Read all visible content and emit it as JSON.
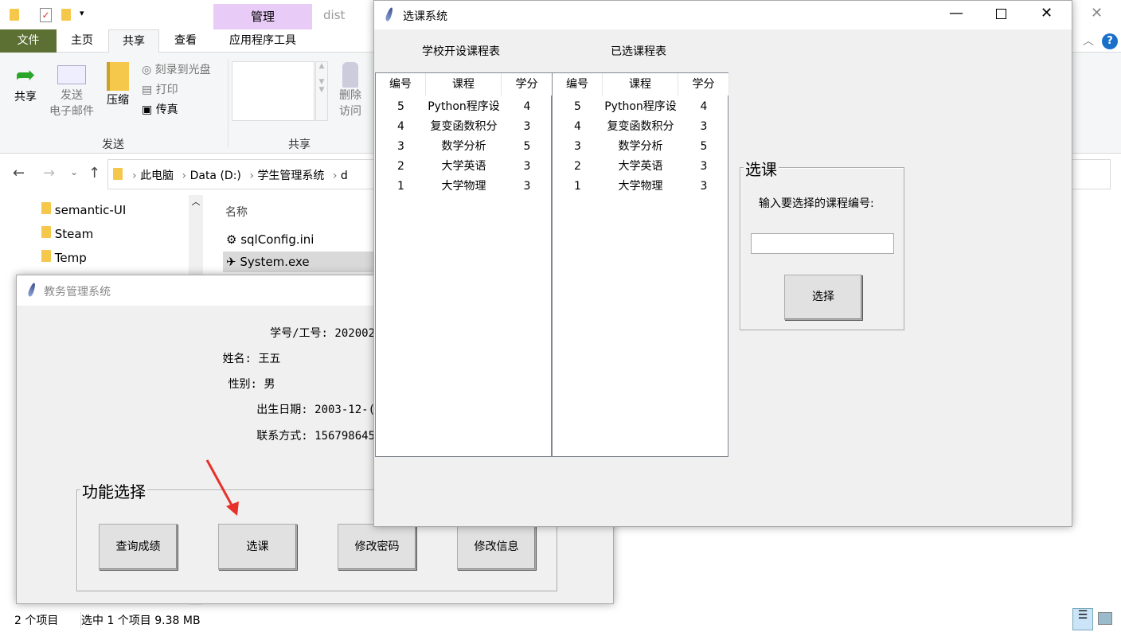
{
  "explorer": {
    "context_tab": "管理",
    "title": "dist",
    "tabs": [
      "文件",
      "主页",
      "共享",
      "查看",
      "应用程序工具"
    ],
    "ribbon": {
      "share": "共享",
      "send_email_1": "发送",
      "send_email_2": "电子邮件",
      "zip": "压缩",
      "burn": "刻录到光盘",
      "print": "打印",
      "fax": "传真",
      "remove_1": "删除",
      "remove_2": "访问",
      "group_send": "发送",
      "group_share": "共享"
    },
    "breadcrumb": [
      "此电脑",
      "Data (D:)",
      "学生管理系统",
      "d"
    ],
    "nav_items": [
      "semantic-UI",
      "Steam",
      "Temp"
    ],
    "column_name": "名称",
    "files": [
      "sqlConfig.ini",
      "System.exe"
    ],
    "status": {
      "count": "2 个项目",
      "selected": "选中 1 个项目  9.38 MB"
    }
  },
  "main_window": {
    "title": "教务管理系统",
    "fields": [
      {
        "label": "学号/工号:",
        "value": "202002"
      },
      {
        "label": "姓名:",
        "value": "王五"
      },
      {
        "label": "性别:",
        "value": "男"
      },
      {
        "label": "出生日期:",
        "value": "2003-12-("
      },
      {
        "label": "联系方式:",
        "value": "156798645"
      }
    ],
    "group_label": "功能选择",
    "buttons": [
      "查询成绩",
      "选课",
      "修改密码",
      "修改信息"
    ]
  },
  "course_window": {
    "title": "选课系统",
    "offered_label": "学校开设课程表",
    "selected_label": "已选课程表",
    "columns": [
      "编号",
      "课程",
      "学分"
    ],
    "offered_rows": [
      [
        "5",
        "Python程序设",
        "4"
      ],
      [
        "4",
        "复变函数积分",
        "3"
      ],
      [
        "3",
        "数学分析",
        "5"
      ],
      [
        "2",
        "大学英语",
        "3"
      ],
      [
        "1",
        "大学物理",
        "3"
      ]
    ],
    "selected_rows": [
      [
        "5",
        "Python程序设",
        "4"
      ],
      [
        "4",
        "复变函数积分",
        "3"
      ],
      [
        "3",
        "数学分析",
        "5"
      ],
      [
        "2",
        "大学英语",
        "3"
      ],
      [
        "1",
        "大学物理",
        "3"
      ]
    ],
    "select_group_label": "选课",
    "prompt": "输入要选择的课程编号:",
    "input_value": "",
    "select_button": "选择"
  }
}
